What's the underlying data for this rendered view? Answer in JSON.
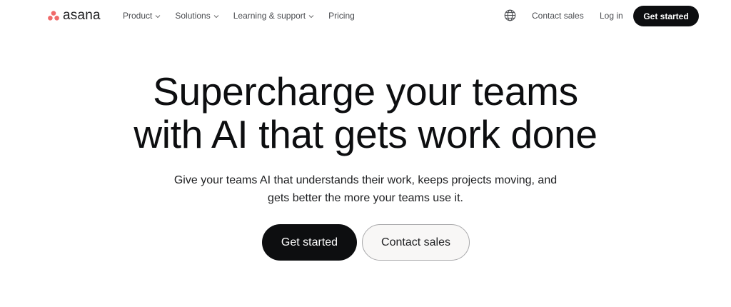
{
  "header": {
    "logo_text": "asana",
    "brand_color": "#f06a6a",
    "nav": [
      {
        "label": "Product",
        "icon": "chevron-down-icon"
      },
      {
        "label": "Solutions",
        "icon": "chevron-down-icon"
      },
      {
        "label": "Learning & support",
        "icon": "chevron-down-icon"
      },
      {
        "label": "Pricing"
      }
    ],
    "language_icon": "globe-icon",
    "contact_sales": "Contact sales",
    "log_in": "Log in",
    "get_started": "Get started"
  },
  "hero": {
    "title_line1": "Supercharge your teams",
    "title_line2": "with AI that gets work done",
    "subtitle_line1": "Give your teams AI that understands their work, keeps projects moving, and",
    "subtitle_line2": "gets better the more your teams use it.",
    "primary_cta": "Get started",
    "secondary_cta": "Contact sales"
  }
}
